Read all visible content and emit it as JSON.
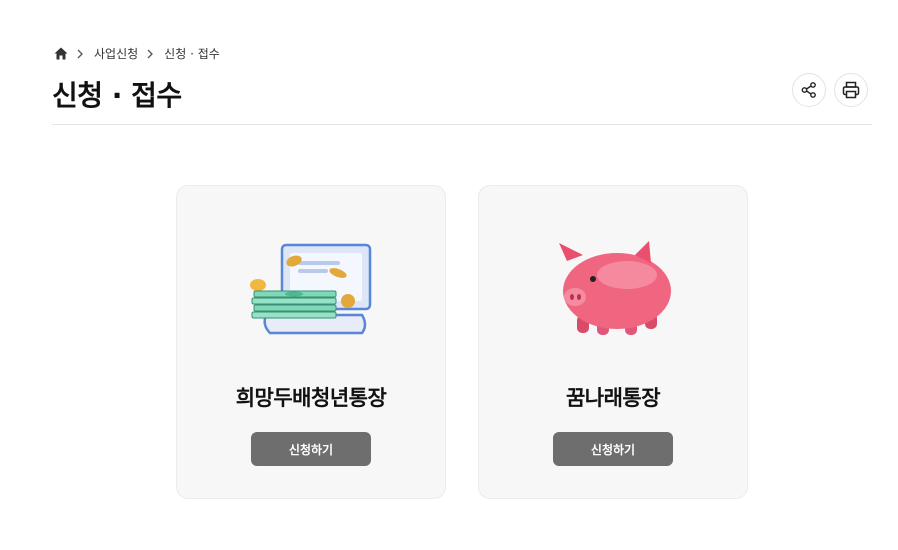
{
  "breadcrumb": {
    "home_icon": "home-icon",
    "items": [
      {
        "label": "사업신청"
      },
      {
        "label": "신청 · 접수"
      }
    ]
  },
  "page": {
    "title": "신청 · 접수"
  },
  "tools": [
    {
      "icon": "share-icon"
    },
    {
      "icon": "print-icon"
    }
  ],
  "cards": [
    {
      "title": "희망두배청년통장",
      "button_label": "신청하기",
      "illustration": "money-laptop-illustration"
    },
    {
      "title": "꿈나래통장",
      "button_label": "신청하기",
      "illustration": "piggy-bank-illustration"
    }
  ],
  "colors": {
    "button_bg": "#6e6e6e",
    "card_bg": "#f7f7f7",
    "piggy": "#f0657f"
  }
}
